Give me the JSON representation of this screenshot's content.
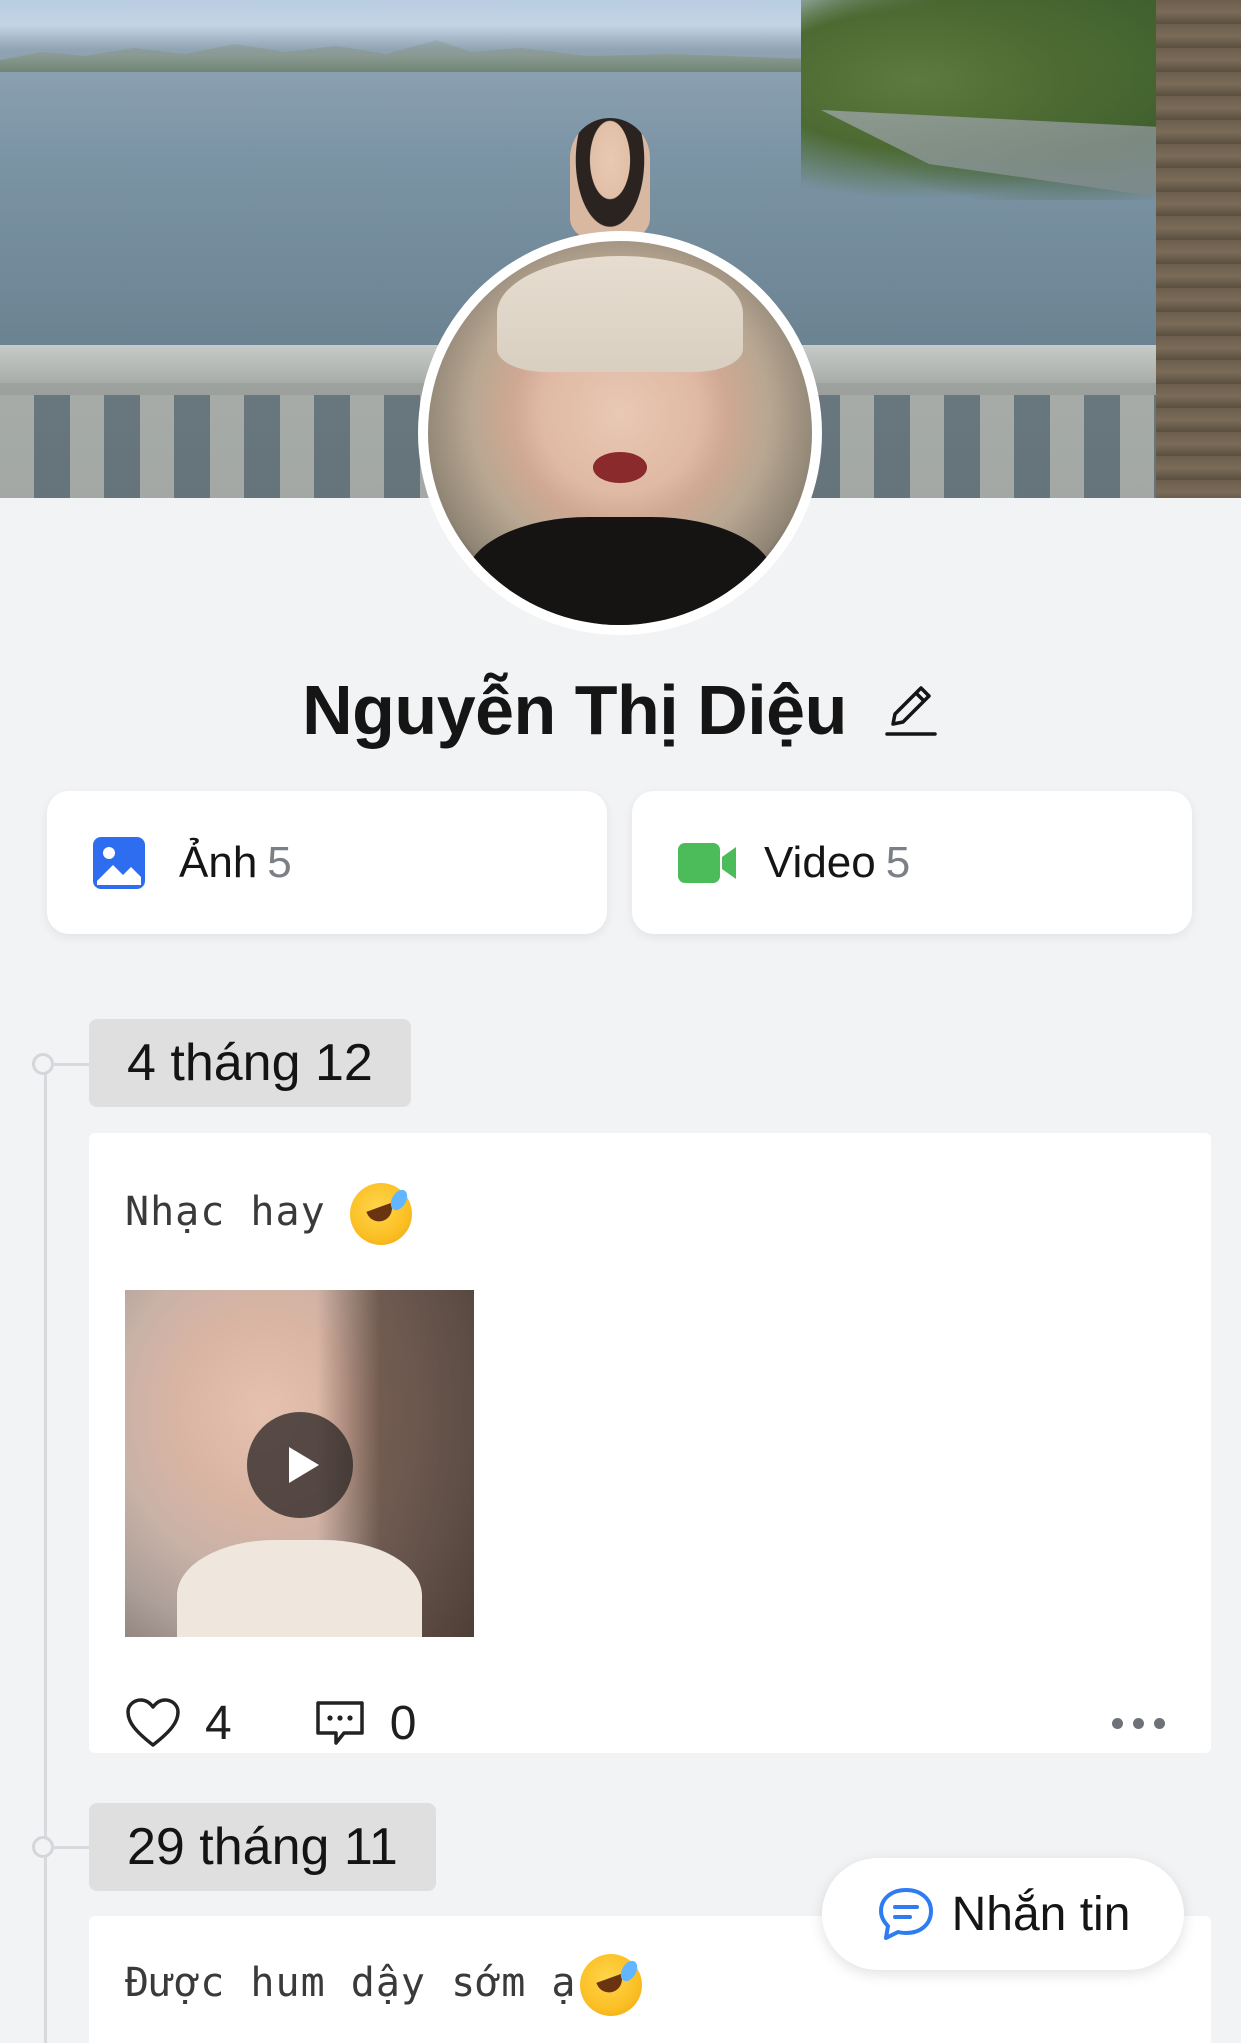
{
  "profile": {
    "name": "Nguyễn Thị Diệu"
  },
  "media": {
    "photos": {
      "label": "Ảnh",
      "count": "5",
      "icon": "image-icon",
      "color": "#2f6df0"
    },
    "videos": {
      "label": "Video",
      "count": "5",
      "icon": "video-camera-icon",
      "color": "#4cbb5a"
    }
  },
  "timeline": [
    {
      "date": "4 tháng 12",
      "text": "Nhạc hay",
      "likes": "4",
      "comments": "0"
    },
    {
      "date": "29 tháng 11",
      "text": "Được hum dậy sớm ạ"
    }
  ],
  "actions": {
    "message_label": "Nhắn tin"
  },
  "colors": {
    "background": "#f2f3f5",
    "card": "#ffffff",
    "badge": "#dfdfe0",
    "message_icon": "#2f7bf2"
  }
}
